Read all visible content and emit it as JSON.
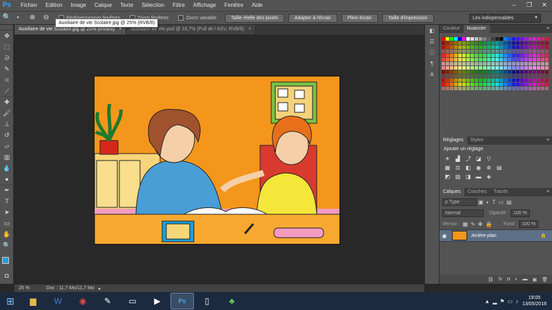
{
  "app": {
    "logo": "Ps"
  },
  "menu": [
    "Fichier",
    "Edition",
    "Image",
    "Calque",
    "Texte",
    "Sélection",
    "Filtre",
    "Affichage",
    "Fenêtre",
    "Aide"
  ],
  "window_controls": {
    "minimize": "–",
    "restore": "❐",
    "close": "✕"
  },
  "options": {
    "resize_windows_label": "Redimensionner fenêtres",
    "zoom_all_label": "Zoom fenêtres",
    "scrubby_zoom_label": "Zoom variable",
    "actual_pixels_label": "Taille réelle des pixels",
    "fit_screen_label": "Adapter à l'écran",
    "fill_screen_label": "Plein écran",
    "print_size_label": "Taille d'impression",
    "workspace": "Les indispensables"
  },
  "tooltip": "Auxiliaire de vie Scolaire.jpg @ 25% (RVB/8)",
  "tabs": [
    {
      "label": "Auxiliaire de vie Scolaire.jpg @ 25% (RVB/8)",
      "close": "×"
    },
    {
      "label": "Auxiliaire de Vie.psd @ 16,7% (Pull de l ASV, RVB/8)",
      "close": "×"
    }
  ],
  "status": {
    "zoom": "25 %",
    "doc": "Doc : 11,7 Mo/11,7 Mo",
    "arrow": "▸"
  },
  "swatches_panel": {
    "tab_color": "Couleur",
    "tab_swatches": "Nuancier",
    "menu": "≡"
  },
  "adjust_panel": {
    "tab_adjust": "Réglages",
    "tab_styles": "Styles",
    "title": "Ajouter un réglage",
    "menu": "≡"
  },
  "layers_panel": {
    "tab_layers": "Calques",
    "tab_channels": "Couches",
    "tab_paths": "Tracés",
    "menu": "≡",
    "filter_type": "ρ Type",
    "blend_mode": "Normal",
    "opacity_label": "Opacité :",
    "opacity_value": "100 %",
    "lock_label": "Verrou :",
    "fill_label": "Fond :",
    "fill_value": "100 %",
    "layer_name": "Arrière-plan"
  },
  "taskbar": {
    "time": "19:05",
    "date": "13/05/2018"
  },
  "colors": {
    "accent": "#31a8ff",
    "foreground_color": "#1aa0dc",
    "background_color": "#ffffff",
    "artwork_orange": "#f5961c",
    "selected_layer": "#5d6f86"
  }
}
